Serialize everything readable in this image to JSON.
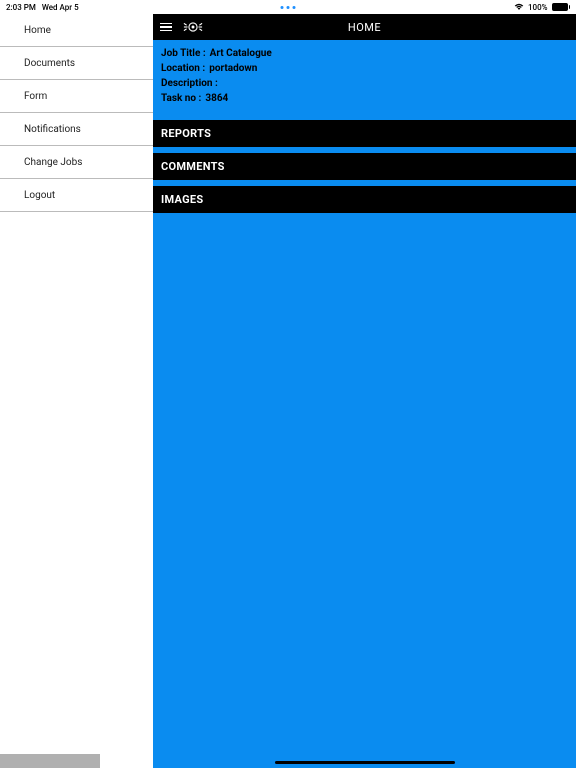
{
  "status": {
    "time": "2:03 PM",
    "date": "Wed Apr 5",
    "battery_level": "100%",
    "wifi": "wifi"
  },
  "sidebar": {
    "items": [
      {
        "label": "Home"
      },
      {
        "label": "Documents"
      },
      {
        "label": "Form"
      },
      {
        "label": "Notifications"
      },
      {
        "label": "Change Jobs"
      },
      {
        "label": "Logout"
      }
    ]
  },
  "header": {
    "title": "HOME"
  },
  "info": {
    "job_title_label": "Job Title :",
    "job_title_value": "Art Catalogue",
    "location_label": "Location :",
    "location_value": "portadown",
    "description_label": "Description :",
    "description_value": "",
    "task_no_label": "Task no :",
    "task_no_value": "3864"
  },
  "sections": {
    "reports": "REPORTS",
    "comments": "COMMENTS",
    "images": "IMAGES"
  }
}
